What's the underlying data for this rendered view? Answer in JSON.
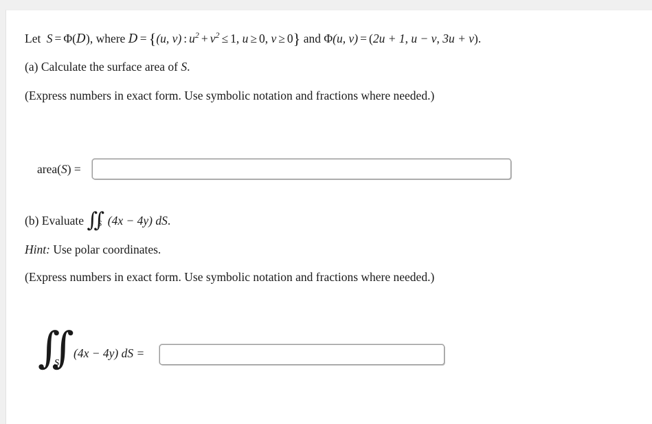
{
  "problem": {
    "setup": {
      "prefix": "Let",
      "S_symbol": "S",
      "equals": "=",
      "phi": "Φ",
      "D_symbol": "D",
      "open_paren": "(",
      "close_paren": ")",
      "where": ", where",
      "set_open": "{",
      "set_close": "}",
      "uv_pair": "(u, v)",
      "colon": ":",
      "u_var": "u",
      "v_var": "v",
      "exp_two": "2",
      "plus": "+",
      "minus": "−",
      "leq": "≤",
      "geq": "≥",
      "one": "1",
      "zero": "0",
      "comma": ",",
      "and_word": "and",
      "map_first": "2u + 1",
      "map_second": "u − v",
      "map_third": "3u + v",
      "period": "."
    },
    "part_a": {
      "label": "(a)",
      "text": "Calculate the surface area of",
      "symbol": "S",
      "period": ".",
      "instructions": "(Express numbers in exact form. Use symbolic notation and fractions where needed.)",
      "answer_label_prefix": "area(",
      "answer_label_symbol": "S",
      "answer_label_suffix": ") =",
      "answer_value": "",
      "answer_placeholder": ""
    },
    "part_b": {
      "label": "(b)",
      "text": "Evaluate",
      "integral_glyph": "∬",
      "integral_subscript": "S",
      "integrand": "(4x − 4y) dS",
      "period": ".",
      "hint_label": "Hint:",
      "hint_text": "Use polar coordinates.",
      "instructions": "(Express numbers in exact form. Use symbolic notation and fractions where needed.)",
      "answer_expr": "(4x − 4y) dS =",
      "answer_value": "",
      "answer_placeholder": ""
    }
  },
  "colors": {
    "page_background": "#f0f0f0",
    "card_background": "#ffffff",
    "text": "#1a1a1a",
    "input_border": "#9a9a9a",
    "input_shadow": "#bdbdbd"
  }
}
